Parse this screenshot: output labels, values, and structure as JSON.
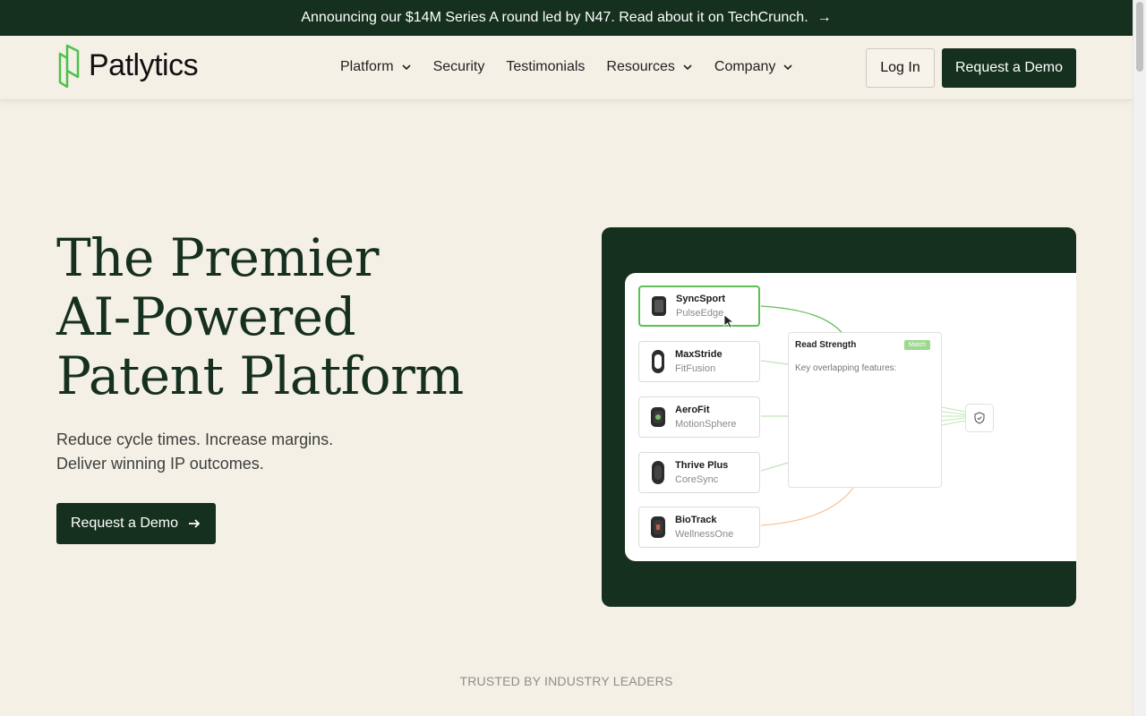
{
  "announcement": {
    "text": "Announcing our $14M Series A round led by N47. Read about it on TechCrunch.",
    "arrow_icon": "arrow-right-icon"
  },
  "header": {
    "brand": "Patlytics",
    "nav": [
      {
        "label": "Platform",
        "dropdown": true
      },
      {
        "label": "Security",
        "dropdown": false
      },
      {
        "label": "Testimonials",
        "dropdown": false
      },
      {
        "label": "Resources",
        "dropdown": true
      },
      {
        "label": "Company",
        "dropdown": true
      }
    ],
    "login_label": "Log In",
    "demo_label": "Request a Demo"
  },
  "hero": {
    "title_line1": "The Premier",
    "title_line2": "AI-Powered",
    "title_line3": "Patent Platform",
    "sub_line1": "Reduce cycle times. Increase margins.",
    "sub_line2": "Deliver winning IP outcomes.",
    "cta_label": "Request a Demo"
  },
  "illustration": {
    "products": [
      {
        "name": "SyncSport",
        "company": "PulseEdge",
        "active": true
      },
      {
        "name": "MaxStride",
        "company": "FitFusion",
        "active": false
      },
      {
        "name": "AeroFit",
        "company": "MotionSphere",
        "active": false
      },
      {
        "name": "Thrive Plus",
        "company": "CoreSync",
        "active": false
      },
      {
        "name": "BioTrack",
        "company": "WellnessOne",
        "active": false
      }
    ],
    "detail_title": "Read Strength",
    "detail_badge": "Match",
    "detail_key": "Key overlapping features:"
  },
  "trusted": {
    "label": "TRUSTED BY INDUSTRY LEADERS"
  },
  "colors": {
    "brand_dark": "#16301f",
    "accent_green": "#5fbf55",
    "background": "#f5f0e6",
    "accent_orange": "#f4c49a"
  }
}
